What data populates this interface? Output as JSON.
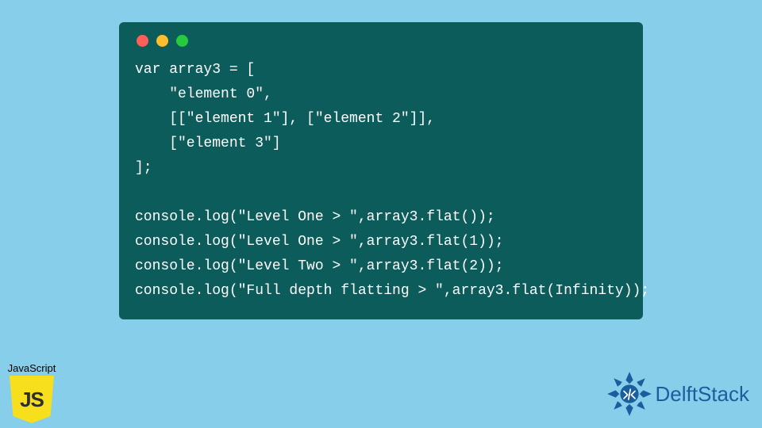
{
  "code_lines": [
    "var array3 = [",
    "    \"element 0\",",
    "    [[\"element 1\"], [\"element 2\"]],",
    "    [\"element 3\"]",
    "];",
    "",
    "console.log(\"Level One > \",array3.flat());",
    "console.log(\"Level One > \",array3.flat(1));",
    "console.log(\"Level Two > \",array3.flat(2));",
    "console.log(\"Full depth flatting > \",array3.flat(Infinity));"
  ],
  "js_badge": {
    "label": "JavaScript",
    "shield_text": "JS"
  },
  "delft": {
    "brand": "DelftStack"
  },
  "traffic": {
    "red": "#ff5f56",
    "yellow": "#ffbd2e",
    "green": "#27c93f"
  }
}
